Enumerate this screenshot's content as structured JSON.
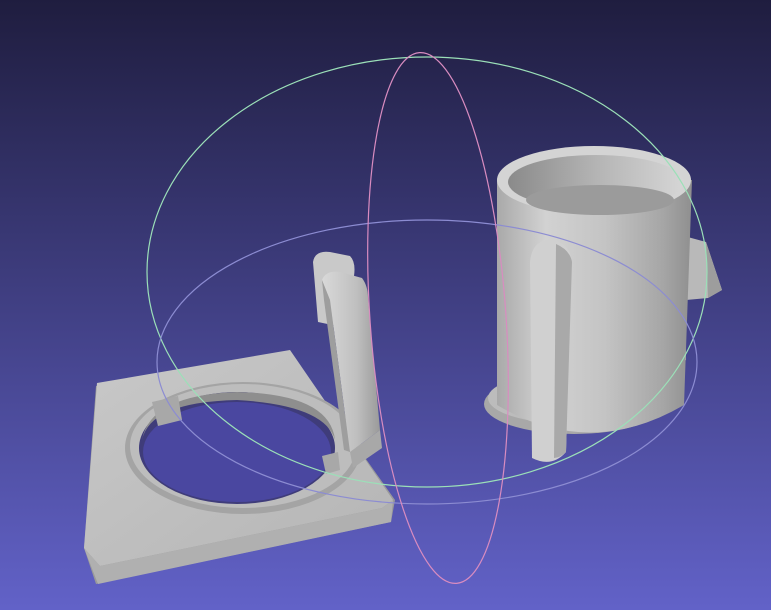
{
  "viewer": {
    "background_top": "#1f1d3f",
    "background_bottom": "#6262c8",
    "mesh_color": "#bdbdbd",
    "mesh_shadow": "#8c8c8c",
    "mesh_highlight": "#e2e2e2",
    "trackball": {
      "horizontal_ring_color": "#8c8cd2",
      "vertical_ring_color": "#d98cc0",
      "outer_ring_color": "#9be0b8"
    }
  },
  "icons": {
    "trackball": "trackball-gizmo"
  }
}
